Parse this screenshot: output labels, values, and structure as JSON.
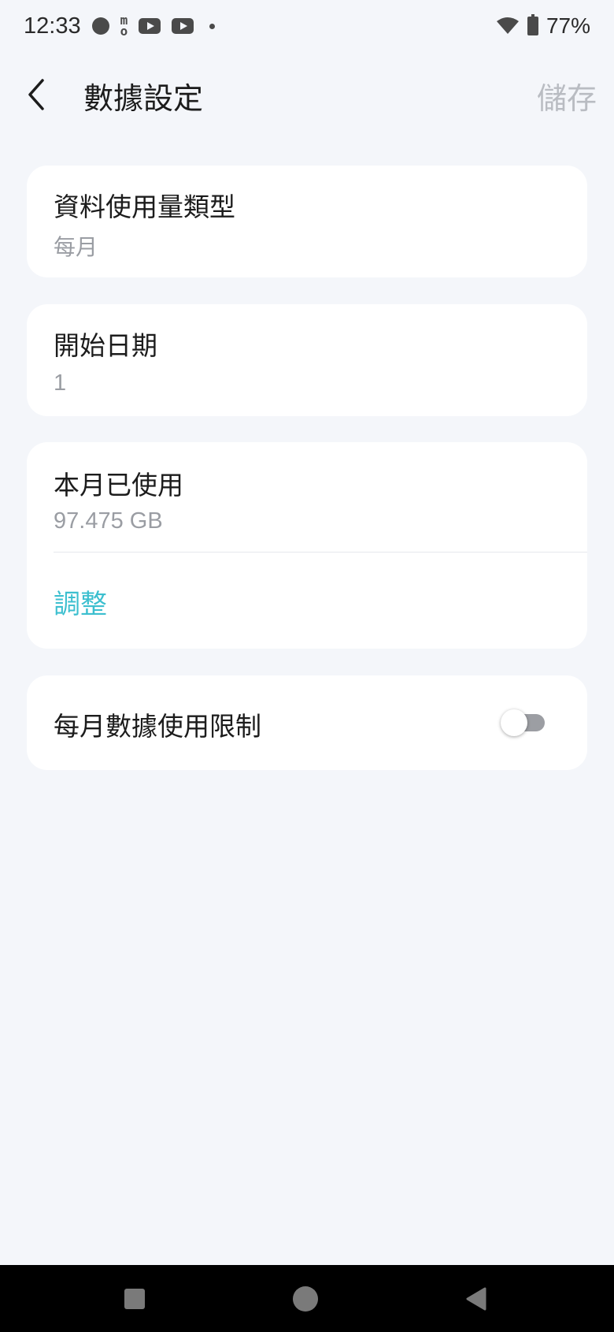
{
  "status_bar": {
    "time": "12:33",
    "notification_icons": [
      "record-dot-icon",
      "momo-icon",
      "youtube-icon",
      "youtube-icon",
      "more-dot-icon"
    ],
    "battery": "77%"
  },
  "header": {
    "title": "數據設定",
    "save_label": "儲存"
  },
  "settings": {
    "usage_type": {
      "label": "資料使用量類型",
      "value": "每月"
    },
    "start_date": {
      "label": "開始日期",
      "value": "1"
    },
    "used_this_month": {
      "label": "本月已使用",
      "value": "97.475 GB",
      "action": "調整"
    },
    "monthly_limit": {
      "label": "每月數據使用限制",
      "enabled": false
    }
  },
  "colors": {
    "background": "#f4f6fa",
    "card": "#ffffff",
    "accent": "#3cbfcf",
    "secondary_text": "#9a9da3",
    "disabled_text": "#b9bcc2"
  }
}
